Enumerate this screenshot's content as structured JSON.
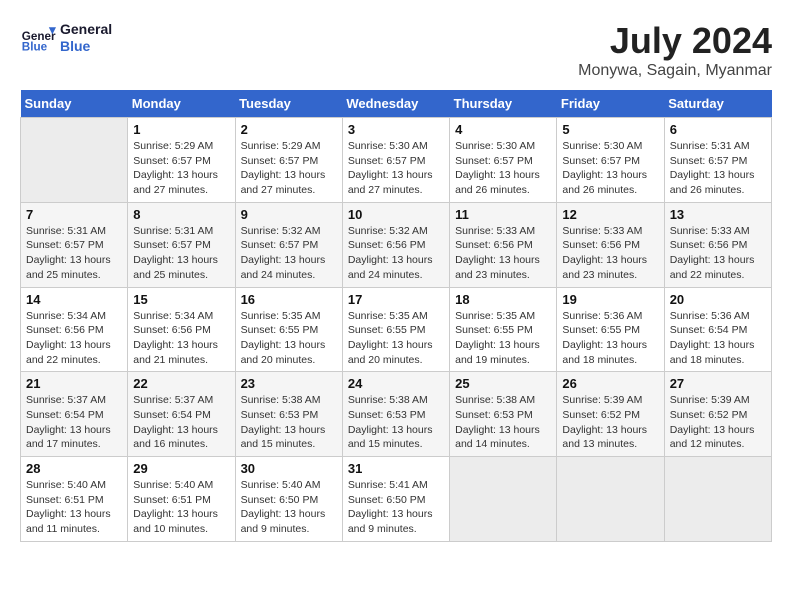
{
  "header": {
    "logo_line1": "General",
    "logo_line2": "Blue",
    "month_year": "July 2024",
    "location": "Monywa, Sagain, Myanmar"
  },
  "weekdays": [
    "Sunday",
    "Monday",
    "Tuesday",
    "Wednesday",
    "Thursday",
    "Friday",
    "Saturday"
  ],
  "weeks": [
    [
      {
        "day": "",
        "info": ""
      },
      {
        "day": "1",
        "info": "Sunrise: 5:29 AM\nSunset: 6:57 PM\nDaylight: 13 hours\nand 27 minutes."
      },
      {
        "day": "2",
        "info": "Sunrise: 5:29 AM\nSunset: 6:57 PM\nDaylight: 13 hours\nand 27 minutes."
      },
      {
        "day": "3",
        "info": "Sunrise: 5:30 AM\nSunset: 6:57 PM\nDaylight: 13 hours\nand 27 minutes."
      },
      {
        "day": "4",
        "info": "Sunrise: 5:30 AM\nSunset: 6:57 PM\nDaylight: 13 hours\nand 26 minutes."
      },
      {
        "day": "5",
        "info": "Sunrise: 5:30 AM\nSunset: 6:57 PM\nDaylight: 13 hours\nand 26 minutes."
      },
      {
        "day": "6",
        "info": "Sunrise: 5:31 AM\nSunset: 6:57 PM\nDaylight: 13 hours\nand 26 minutes."
      }
    ],
    [
      {
        "day": "7",
        "info": "Sunrise: 5:31 AM\nSunset: 6:57 PM\nDaylight: 13 hours\nand 25 minutes."
      },
      {
        "day": "8",
        "info": "Sunrise: 5:31 AM\nSunset: 6:57 PM\nDaylight: 13 hours\nand 25 minutes."
      },
      {
        "day": "9",
        "info": "Sunrise: 5:32 AM\nSunset: 6:57 PM\nDaylight: 13 hours\nand 24 minutes."
      },
      {
        "day": "10",
        "info": "Sunrise: 5:32 AM\nSunset: 6:56 PM\nDaylight: 13 hours\nand 24 minutes."
      },
      {
        "day": "11",
        "info": "Sunrise: 5:33 AM\nSunset: 6:56 PM\nDaylight: 13 hours\nand 23 minutes."
      },
      {
        "day": "12",
        "info": "Sunrise: 5:33 AM\nSunset: 6:56 PM\nDaylight: 13 hours\nand 23 minutes."
      },
      {
        "day": "13",
        "info": "Sunrise: 5:33 AM\nSunset: 6:56 PM\nDaylight: 13 hours\nand 22 minutes."
      }
    ],
    [
      {
        "day": "14",
        "info": "Sunrise: 5:34 AM\nSunset: 6:56 PM\nDaylight: 13 hours\nand 22 minutes."
      },
      {
        "day": "15",
        "info": "Sunrise: 5:34 AM\nSunset: 6:56 PM\nDaylight: 13 hours\nand 21 minutes."
      },
      {
        "day": "16",
        "info": "Sunrise: 5:35 AM\nSunset: 6:55 PM\nDaylight: 13 hours\nand 20 minutes."
      },
      {
        "day": "17",
        "info": "Sunrise: 5:35 AM\nSunset: 6:55 PM\nDaylight: 13 hours\nand 20 minutes."
      },
      {
        "day": "18",
        "info": "Sunrise: 5:35 AM\nSunset: 6:55 PM\nDaylight: 13 hours\nand 19 minutes."
      },
      {
        "day": "19",
        "info": "Sunrise: 5:36 AM\nSunset: 6:55 PM\nDaylight: 13 hours\nand 18 minutes."
      },
      {
        "day": "20",
        "info": "Sunrise: 5:36 AM\nSunset: 6:54 PM\nDaylight: 13 hours\nand 18 minutes."
      }
    ],
    [
      {
        "day": "21",
        "info": "Sunrise: 5:37 AM\nSunset: 6:54 PM\nDaylight: 13 hours\nand 17 minutes."
      },
      {
        "day": "22",
        "info": "Sunrise: 5:37 AM\nSunset: 6:54 PM\nDaylight: 13 hours\nand 16 minutes."
      },
      {
        "day": "23",
        "info": "Sunrise: 5:38 AM\nSunset: 6:53 PM\nDaylight: 13 hours\nand 15 minutes."
      },
      {
        "day": "24",
        "info": "Sunrise: 5:38 AM\nSunset: 6:53 PM\nDaylight: 13 hours\nand 15 minutes."
      },
      {
        "day": "25",
        "info": "Sunrise: 5:38 AM\nSunset: 6:53 PM\nDaylight: 13 hours\nand 14 minutes."
      },
      {
        "day": "26",
        "info": "Sunrise: 5:39 AM\nSunset: 6:52 PM\nDaylight: 13 hours\nand 13 minutes."
      },
      {
        "day": "27",
        "info": "Sunrise: 5:39 AM\nSunset: 6:52 PM\nDaylight: 13 hours\nand 12 minutes."
      }
    ],
    [
      {
        "day": "28",
        "info": "Sunrise: 5:40 AM\nSunset: 6:51 PM\nDaylight: 13 hours\nand 11 minutes."
      },
      {
        "day": "29",
        "info": "Sunrise: 5:40 AM\nSunset: 6:51 PM\nDaylight: 13 hours\nand 10 minutes."
      },
      {
        "day": "30",
        "info": "Sunrise: 5:40 AM\nSunset: 6:50 PM\nDaylight: 13 hours\nand 9 minutes."
      },
      {
        "day": "31",
        "info": "Sunrise: 5:41 AM\nSunset: 6:50 PM\nDaylight: 13 hours\nand 9 minutes."
      },
      {
        "day": "",
        "info": ""
      },
      {
        "day": "",
        "info": ""
      },
      {
        "day": "",
        "info": ""
      }
    ]
  ]
}
